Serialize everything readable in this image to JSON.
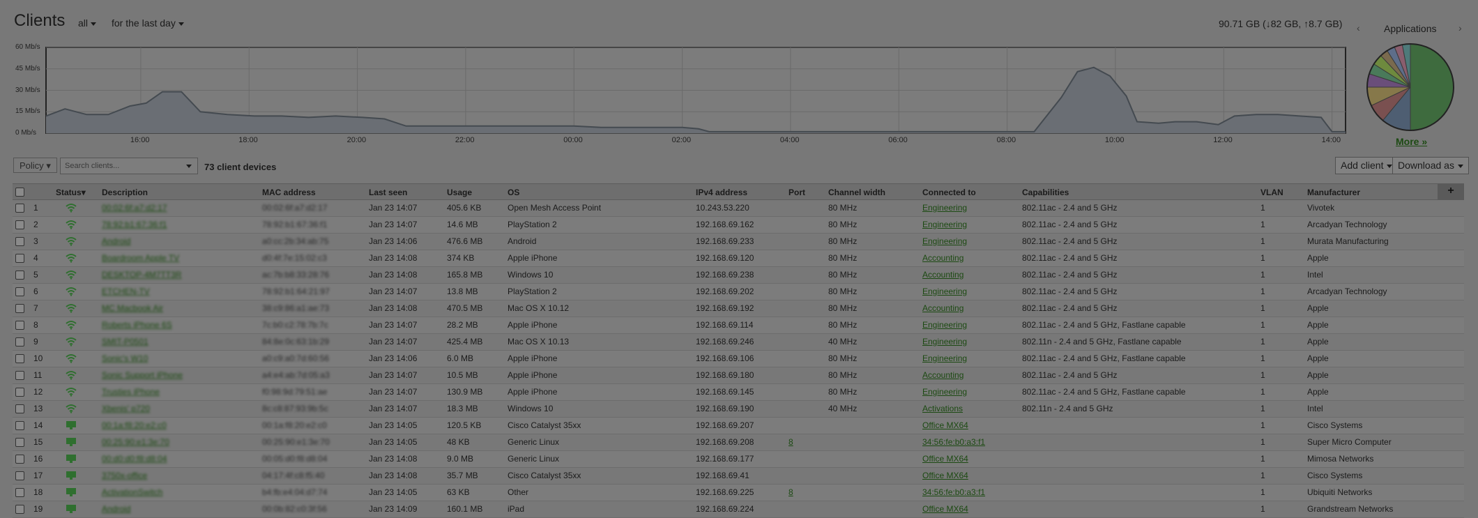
{
  "header": {
    "title": "Clients",
    "filter_all": "all",
    "filter_time": "for the last day",
    "usage_summary": "90.71 GB (↓82 GB, ↑8.7 GB)"
  },
  "applications": {
    "title": "Applications",
    "more_link": "More »",
    "prev_icon": "chevron-left-icon",
    "next_icon": "chevron-right-icon"
  },
  "chart_data": {
    "type": "area",
    "title": "",
    "xlabel": "",
    "ylabel": "",
    "y_ticks": [
      "60 Mb/s",
      "45 Mb/s",
      "30 Mb/s",
      "15 Mb/s",
      "0 Mb/s"
    ],
    "ylim": [
      0,
      60
    ],
    "x_ticks": [
      "16:00",
      "18:00",
      "20:00",
      "22:00",
      "00:00",
      "02:00",
      "04:00",
      "06:00",
      "08:00",
      "10:00",
      "12:00",
      "14:00"
    ],
    "x_start": 14.25,
    "x_end": 38.25,
    "points": [
      [
        14.25,
        12
      ],
      [
        14.6,
        17
      ],
      [
        15.0,
        13
      ],
      [
        15.4,
        13
      ],
      [
        15.8,
        19
      ],
      [
        16.1,
        21
      ],
      [
        16.4,
        29
      ],
      [
        16.75,
        29
      ],
      [
        17.1,
        15
      ],
      [
        17.6,
        13
      ],
      [
        18.1,
        12
      ],
      [
        18.6,
        12
      ],
      [
        19.1,
        11
      ],
      [
        19.6,
        12
      ],
      [
        20.1,
        11
      ],
      [
        20.5,
        10
      ],
      [
        20.9,
        5
      ],
      [
        21.4,
        5
      ],
      [
        22.0,
        5
      ],
      [
        22.5,
        5
      ],
      [
        23.0,
        5
      ],
      [
        23.5,
        5
      ],
      [
        24.0,
        5
      ],
      [
        24.5,
        4
      ],
      [
        25.0,
        4
      ],
      [
        25.5,
        4
      ],
      [
        26.0,
        4
      ],
      [
        26.3,
        3
      ],
      [
        26.5,
        1
      ],
      [
        27.0,
        1
      ],
      [
        28.0,
        1
      ],
      [
        29.0,
        1
      ],
      [
        30.0,
        1
      ],
      [
        31.0,
        1
      ],
      [
        32.0,
        1
      ],
      [
        32.5,
        1
      ],
      [
        33.0,
        25
      ],
      [
        33.3,
        43
      ],
      [
        33.6,
        46
      ],
      [
        33.9,
        40
      ],
      [
        34.2,
        26
      ],
      [
        34.4,
        8
      ],
      [
        34.8,
        7
      ],
      [
        35.1,
        8
      ],
      [
        35.5,
        8
      ],
      [
        35.9,
        6
      ],
      [
        36.2,
        12
      ],
      [
        36.6,
        13
      ],
      [
        37.0,
        13
      ],
      [
        37.4,
        12
      ],
      [
        37.8,
        11
      ],
      [
        38.0,
        1
      ],
      [
        38.25,
        1
      ]
    ],
    "grid": true,
    "area_color": "#6a6e74",
    "line_color": "#444a50"
  },
  "pie_data": {
    "type": "pie",
    "slices": [
      {
        "value": 50,
        "color": "#3e6b3e"
      },
      {
        "value": 11,
        "color": "#4e5e72"
      },
      {
        "value": 7,
        "color": "#7a5050"
      },
      {
        "value": 7,
        "color": "#86784a"
      },
      {
        "value": 5,
        "color": "#6a4e7a"
      },
      {
        "value": 4,
        "color": "#4a7a5a"
      },
      {
        "value": 4,
        "color": "#6e8a3e"
      },
      {
        "value": 3,
        "color": "#7a6a4e"
      },
      {
        "value": 3,
        "color": "#5e6e8a"
      },
      {
        "value": 3,
        "color": "#8a5e6e"
      },
      {
        "value": 3,
        "color": "#4e7a7a"
      }
    ]
  },
  "toolbar": {
    "policy_label": "Policy",
    "search_placeholder": "Search clients...",
    "device_count": "73 client devices",
    "add_client_label": "Add client",
    "download_label": "Download as",
    "add_column_label": "+"
  },
  "table": {
    "columns": [
      "Status",
      "Description",
      "MAC address",
      "Last seen",
      "Usage",
      "OS",
      "IPv4 address",
      "Port",
      "Channel width",
      "Connected to",
      "Capabilities",
      "VLAN",
      "Manufacturer"
    ],
    "sort_indicator": "▾",
    "rows": [
      {
        "num": "1",
        "status": "wifi",
        "desc": "00:02:6f:a7:d2:17",
        "mac": "00:02:6f:a7:d2:17",
        "seen": "Jan 23 14:07",
        "usage": "405.6 KB",
        "os": "Open Mesh Access Point",
        "ip": "10.243.53.220",
        "port": "",
        "width": "80 MHz",
        "conn": "Engineering",
        "cap": "802.11ac - 2.4 and 5 GHz",
        "vlan": "1",
        "mfr": "Vivotek"
      },
      {
        "num": "2",
        "status": "wifi",
        "desc": "78:92:b1:67:36:f1",
        "mac": "78:92:b1:67:36:f1",
        "seen": "Jan 23 14:07",
        "usage": "14.6 MB",
        "os": "PlayStation 2",
        "ip": "192.168.69.162",
        "port": "",
        "width": "80 MHz",
        "conn": "Engineering",
        "cap": "802.11ac - 2.4 and 5 GHz",
        "vlan": "1",
        "mfr": "Arcadyan Technology"
      },
      {
        "num": "3",
        "status": "wifi",
        "desc": "Android",
        "mac": "a0:cc:2b:34:ab:75",
        "seen": "Jan 23 14:06",
        "usage": "476.6 MB",
        "os": "Android",
        "ip": "192.168.69.233",
        "port": "",
        "width": "80 MHz",
        "conn": "Engineering",
        "cap": "802.11ac - 2.4 and 5 GHz",
        "vlan": "1",
        "mfr": "Murata Manufacturing"
      },
      {
        "num": "4",
        "status": "wifi",
        "desc": "Boardroom Apple TV",
        "mac": "d0:4f:7e:15:02:c3",
        "seen": "Jan 23 14:08",
        "usage": "374 KB",
        "os": "Apple iPhone",
        "ip": "192.168.69.120",
        "port": "",
        "width": "80 MHz",
        "conn": "Accounting",
        "cap": "802.11ac - 2.4 and 5 GHz",
        "vlan": "1",
        "mfr": "Apple"
      },
      {
        "num": "5",
        "status": "wifi",
        "desc": "DESKTOP-4M7TT3R",
        "mac": "ac:7b:b8:33:28:76",
        "seen": "Jan 23 14:08",
        "usage": "165.8 MB",
        "os": "Windows 10",
        "ip": "192.168.69.238",
        "port": "",
        "width": "80 MHz",
        "conn": "Accounting",
        "cap": "802.11ac - 2.4 and 5 GHz",
        "vlan": "1",
        "mfr": "Intel"
      },
      {
        "num": "6",
        "status": "wifi",
        "desc": "ETCHEN-TV",
        "mac": "78:92:b1:64:21:97",
        "seen": "Jan 23 14:07",
        "usage": "13.8 MB",
        "os": "PlayStation 2",
        "ip": "192.168.69.202",
        "port": "",
        "width": "80 MHz",
        "conn": "Engineering",
        "cap": "802.11ac - 2.4 and 5 GHz",
        "vlan": "1",
        "mfr": "Arcadyan Technology"
      },
      {
        "num": "7",
        "status": "wifi",
        "desc": "MC Macbook Air",
        "mac": "38:c9:86:a1:ae:73",
        "seen": "Jan 23 14:08",
        "usage": "470.5 MB",
        "os": "Mac OS X 10.12",
        "ip": "192.168.69.192",
        "port": "",
        "width": "80 MHz",
        "conn": "Accounting",
        "cap": "802.11ac - 2.4 and 5 GHz",
        "vlan": "1",
        "mfr": "Apple"
      },
      {
        "num": "8",
        "status": "wifi",
        "desc": "Roberts iPhone 6S",
        "mac": "7c:b0:c2:78:7b:7c",
        "seen": "Jan 23 14:07",
        "usage": "28.2 MB",
        "os": "Apple iPhone",
        "ip": "192.168.69.114",
        "port": "",
        "width": "80 MHz",
        "conn": "Engineering",
        "cap": "802.11ac - 2.4 and 5 GHz, Fastlane capable",
        "vlan": "1",
        "mfr": "Apple"
      },
      {
        "num": "9",
        "status": "wifi",
        "desc": "SMIT-P0501",
        "mac": "84:8e:0c:63:1b:29",
        "seen": "Jan 23 14:07",
        "usage": "425.4 MB",
        "os": "Mac OS X 10.13",
        "ip": "192.168.69.246",
        "port": "",
        "width": "40 MHz",
        "conn": "Engineering",
        "cap": "802.11n - 2.4 and 5 GHz, Fastlane capable",
        "vlan": "1",
        "mfr": "Apple"
      },
      {
        "num": "10",
        "status": "wifi",
        "desc": "Sonic's W10",
        "mac": "a0:c9:a0:7d:60:56",
        "seen": "Jan 23 14:06",
        "usage": "6.0 MB",
        "os": "Apple iPhone",
        "ip": "192.168.69.106",
        "port": "",
        "width": "80 MHz",
        "conn": "Engineering",
        "cap": "802.11ac - 2.4 and 5 GHz, Fastlane capable",
        "vlan": "1",
        "mfr": "Apple"
      },
      {
        "num": "11",
        "status": "wifi",
        "desc": "Sonic Support iPhone",
        "mac": "a4:e4:ab:7d:05:a3",
        "seen": "Jan 23 14:07",
        "usage": "10.5 MB",
        "os": "Apple iPhone",
        "ip": "192.168.69.180",
        "port": "",
        "width": "80 MHz",
        "conn": "Accounting",
        "cap": "802.11ac - 2.4 and 5 GHz",
        "vlan": "1",
        "mfr": "Apple"
      },
      {
        "num": "12",
        "status": "wifi",
        "desc": "Trusties iPhone",
        "mac": "f0:98:9d:79:51:ae",
        "seen": "Jan 23 14:07",
        "usage": "130.9 MB",
        "os": "Apple iPhone",
        "ip": "192.168.69.145",
        "port": "",
        "width": "80 MHz",
        "conn": "Engineering",
        "cap": "802.11ac - 2.4 and 5 GHz, Fastlane capable",
        "vlan": "1",
        "mfr": "Apple"
      },
      {
        "num": "13",
        "status": "wifi",
        "desc": "Xbenis' p720",
        "mac": "8c:c8:87:93:9b:5c",
        "seen": "Jan 23 14:07",
        "usage": "18.3 MB",
        "os": "Windows 10",
        "ip": "192.168.69.190",
        "port": "",
        "width": "40 MHz",
        "conn": "Activations",
        "cap": "802.11n - 2.4 and 5 GHz",
        "vlan": "1",
        "mfr": "Intel"
      },
      {
        "num": "14",
        "status": "wired",
        "desc": "00:1a:f8:20:e2:c0",
        "mac": "00:1a:f8:20:e2:c0",
        "seen": "Jan 23 14:05",
        "usage": "120.5 KB",
        "os": "Cisco Catalyst 35xx",
        "ip": "192.168.69.207",
        "port": "",
        "width": "",
        "conn": "Office MX64",
        "cap": "",
        "vlan": "1",
        "mfr": "Cisco Systems"
      },
      {
        "num": "15",
        "status": "wired",
        "desc": "00:25:90:e1:3e:70",
        "mac": "00:25:90:e1:3e:70",
        "seen": "Jan 23 14:05",
        "usage": "48 KB",
        "os": "Generic Linux",
        "ip": "192.168.69.208",
        "port": "8",
        "width": "",
        "conn": "34:56:fe:b0:a3:f1",
        "cap": "",
        "vlan": "1",
        "mfr": "Super Micro Computer"
      },
      {
        "num": "16",
        "status": "wired",
        "desc": "00:d0:d0:f8:d8:04",
        "mac": "00:05:d0:f8:d8:04",
        "seen": "Jan 23 14:08",
        "usage": "9.0 MB",
        "os": "Generic Linux",
        "ip": "192.168.69.177",
        "port": "",
        "width": "",
        "conn": "Office MX64",
        "cap": "",
        "vlan": "1",
        "mfr": "Mimosa Networks"
      },
      {
        "num": "17",
        "status": "wired",
        "desc": "3750x-office",
        "mac": "04:17:4f:c8:f5:40",
        "seen": "Jan 23 14:08",
        "usage": "35.7 MB",
        "os": "Cisco Catalyst 35xx",
        "ip": "192.168.69.41",
        "port": "",
        "width": "",
        "conn": "Office MX64",
        "cap": "",
        "vlan": "1",
        "mfr": "Cisco Systems"
      },
      {
        "num": "18",
        "status": "wired",
        "desc": "ActivationSwitch",
        "mac": "b4:fb:e4:04:d7:74",
        "seen": "Jan 23 14:05",
        "usage": "63 KB",
        "os": "Other",
        "ip": "192.168.69.225",
        "port": "8",
        "width": "",
        "conn": "34:56:fe:b0:a3:f1",
        "cap": "",
        "vlan": "1",
        "mfr": "Ubiquiti Networks"
      },
      {
        "num": "19",
        "status": "wired",
        "desc": "Android",
        "mac": "00:0b:82:c0:3f:56",
        "seen": "Jan 23 14:09",
        "usage": "160.1 MB",
        "os": "iPad",
        "ip": "192.168.69.224",
        "port": "",
        "width": "",
        "conn": "Office MX64",
        "cap": "",
        "vlan": "1",
        "mfr": "Grandstream Networks"
      }
    ]
  }
}
